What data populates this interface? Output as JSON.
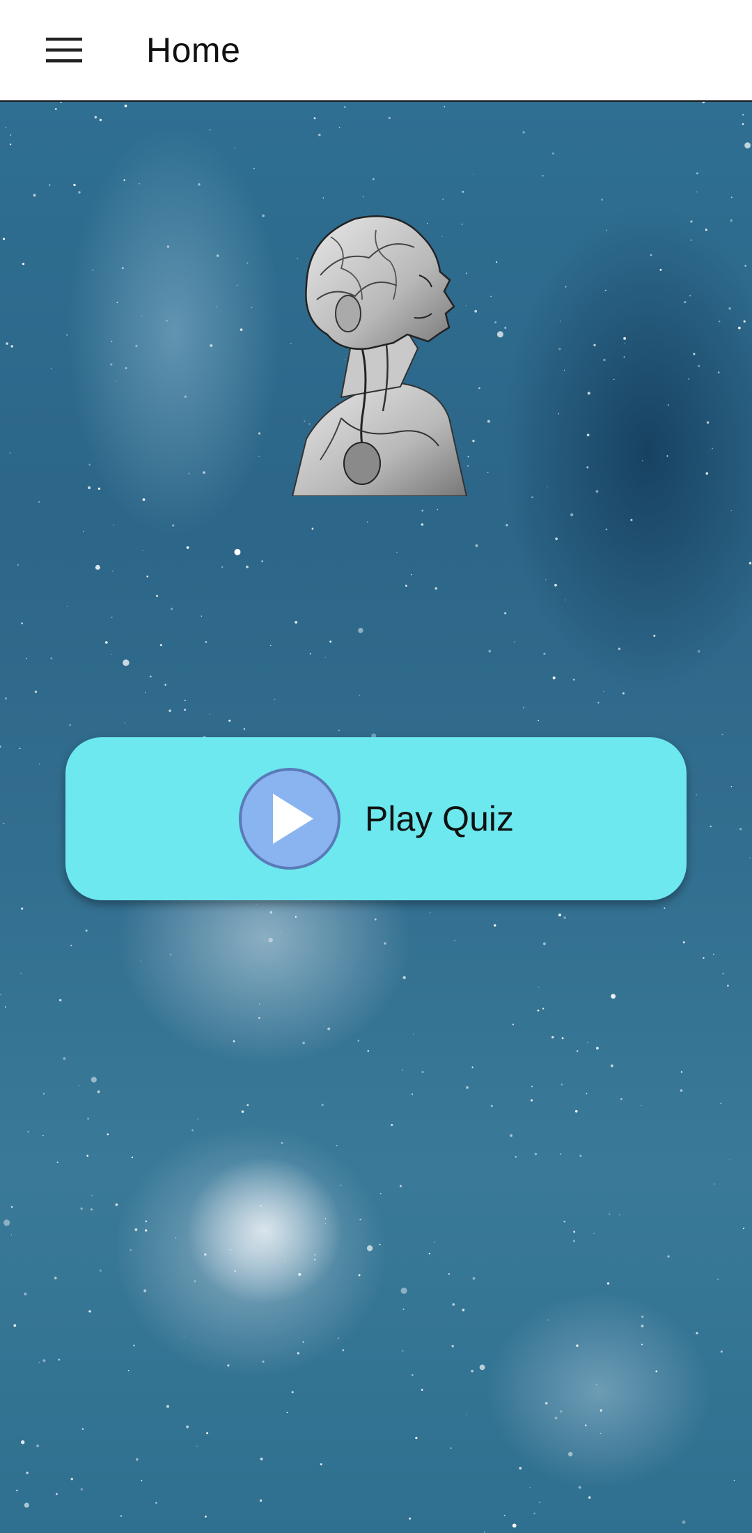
{
  "toolbar": {
    "title": "Home",
    "menu_icon": "hamburger-menu-icon"
  },
  "hero": {
    "image": "anatomical-head-illustration"
  },
  "play_button": {
    "label": "Play Quiz",
    "icon": "play-icon"
  },
  "colors": {
    "toolbar_bg": "#ffffff",
    "button_bg": "#6ce8ee",
    "play_icon_fill": "#8ab4f0",
    "play_icon_stroke": "#5a7ab8",
    "space_bg": "#2f6f92"
  }
}
